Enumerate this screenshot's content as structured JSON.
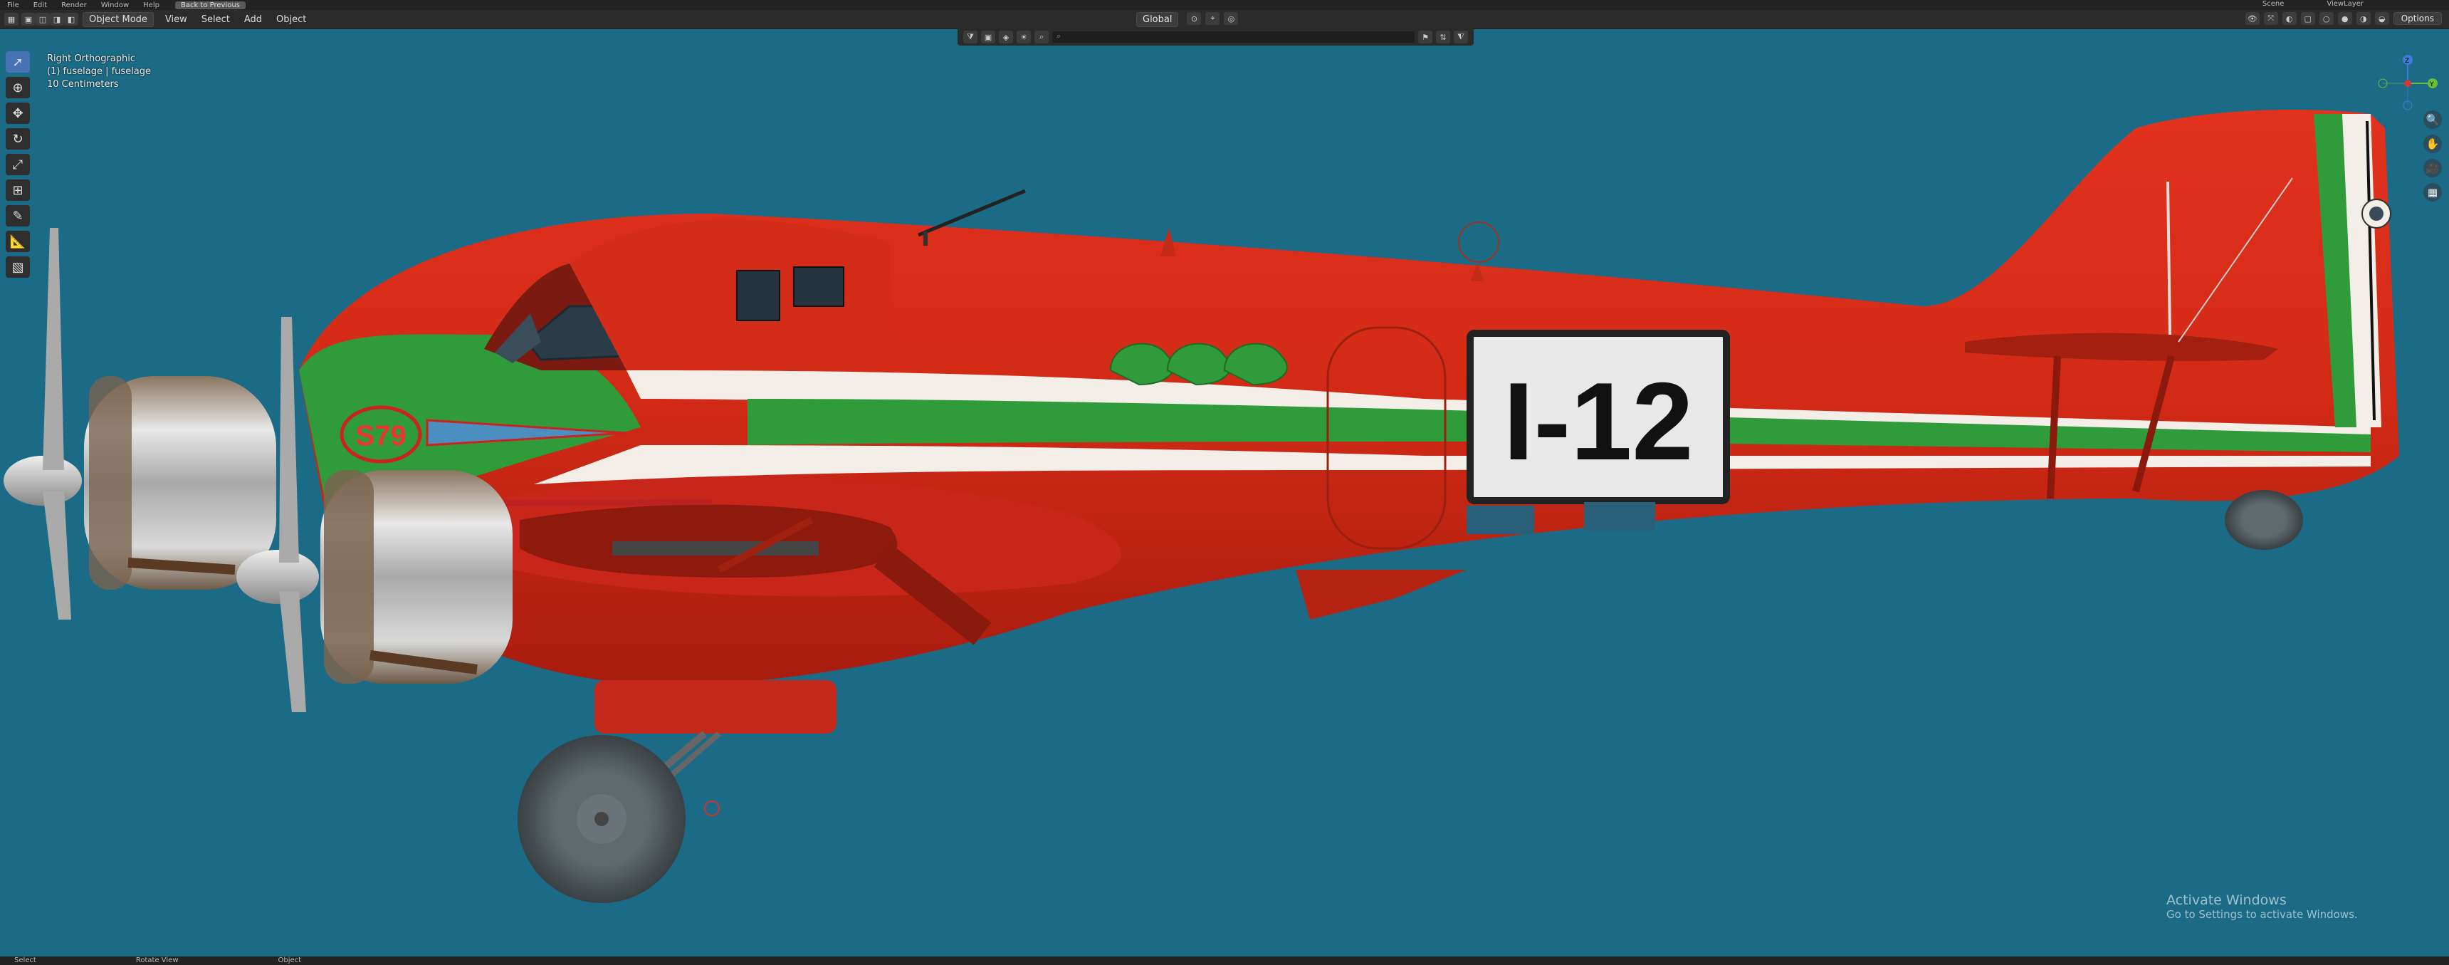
{
  "topbar": {
    "menu": [
      "File",
      "Edit",
      "Render",
      "Window",
      "Help"
    ],
    "back_label": "Back to Previous",
    "scene": "Scene",
    "view_layer": "ViewLayer"
  },
  "header": {
    "mode": "Object Mode",
    "menus": [
      "View",
      "Select",
      "Add",
      "Object"
    ],
    "orientation": "Global",
    "options": "Options"
  },
  "viewport": {
    "view_name": "Right Orthographic",
    "object_info": "(1) fuselage | fuselage",
    "scale": "10 Centimeters"
  },
  "aircraft": {
    "registration": "I-12",
    "nose_badge": "S79"
  },
  "gizmo": {
    "z": "Z",
    "y": "Y"
  },
  "watermark": {
    "title": "Activate Windows",
    "subtitle": "Go to Settings to activate Windows."
  },
  "statusbar": [
    "Select",
    "Rotate View",
    "Object"
  ]
}
